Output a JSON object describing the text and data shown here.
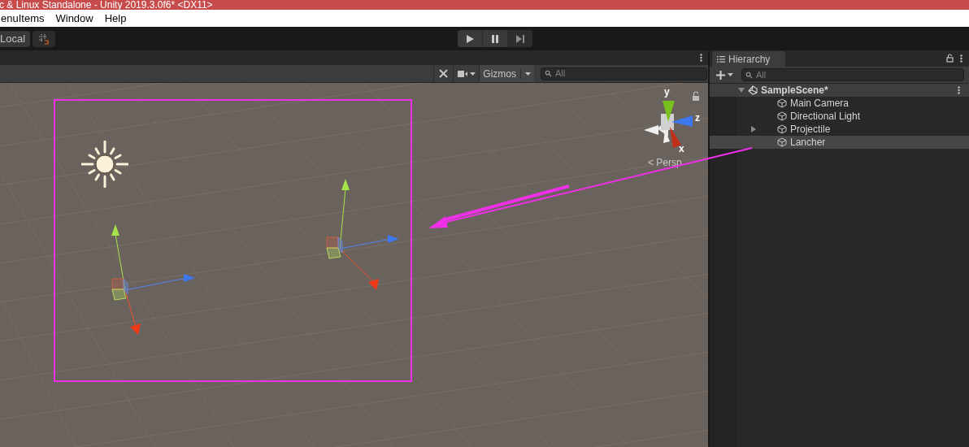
{
  "window": {
    "title": "c & Linux Standalone - Unity 2019.3.0f6* <DX11>"
  },
  "menu": [
    "enuItems",
    "Window",
    "Help"
  ],
  "toolbar": {
    "pivot_mode": "Local"
  },
  "scene_view": {
    "gizmos": "Gizmos",
    "search": {
      "placeholder": "All"
    },
    "axes": [
      "y",
      "z",
      "x"
    ],
    "projection": "< Persp"
  },
  "hierarchy": {
    "title": "Hierarchy",
    "search": {
      "placeholder": "All"
    },
    "scene": {
      "name": "SampleScene*",
      "expanded": true,
      "children": [
        {
          "name": "Main Camera",
          "selected": false
        },
        {
          "name": "Directional Light",
          "selected": false
        },
        {
          "name": "Projectile",
          "selected": false,
          "has_children": true,
          "expanded": false
        },
        {
          "name": "Lancher",
          "selected": true
        }
      ]
    }
  }
}
